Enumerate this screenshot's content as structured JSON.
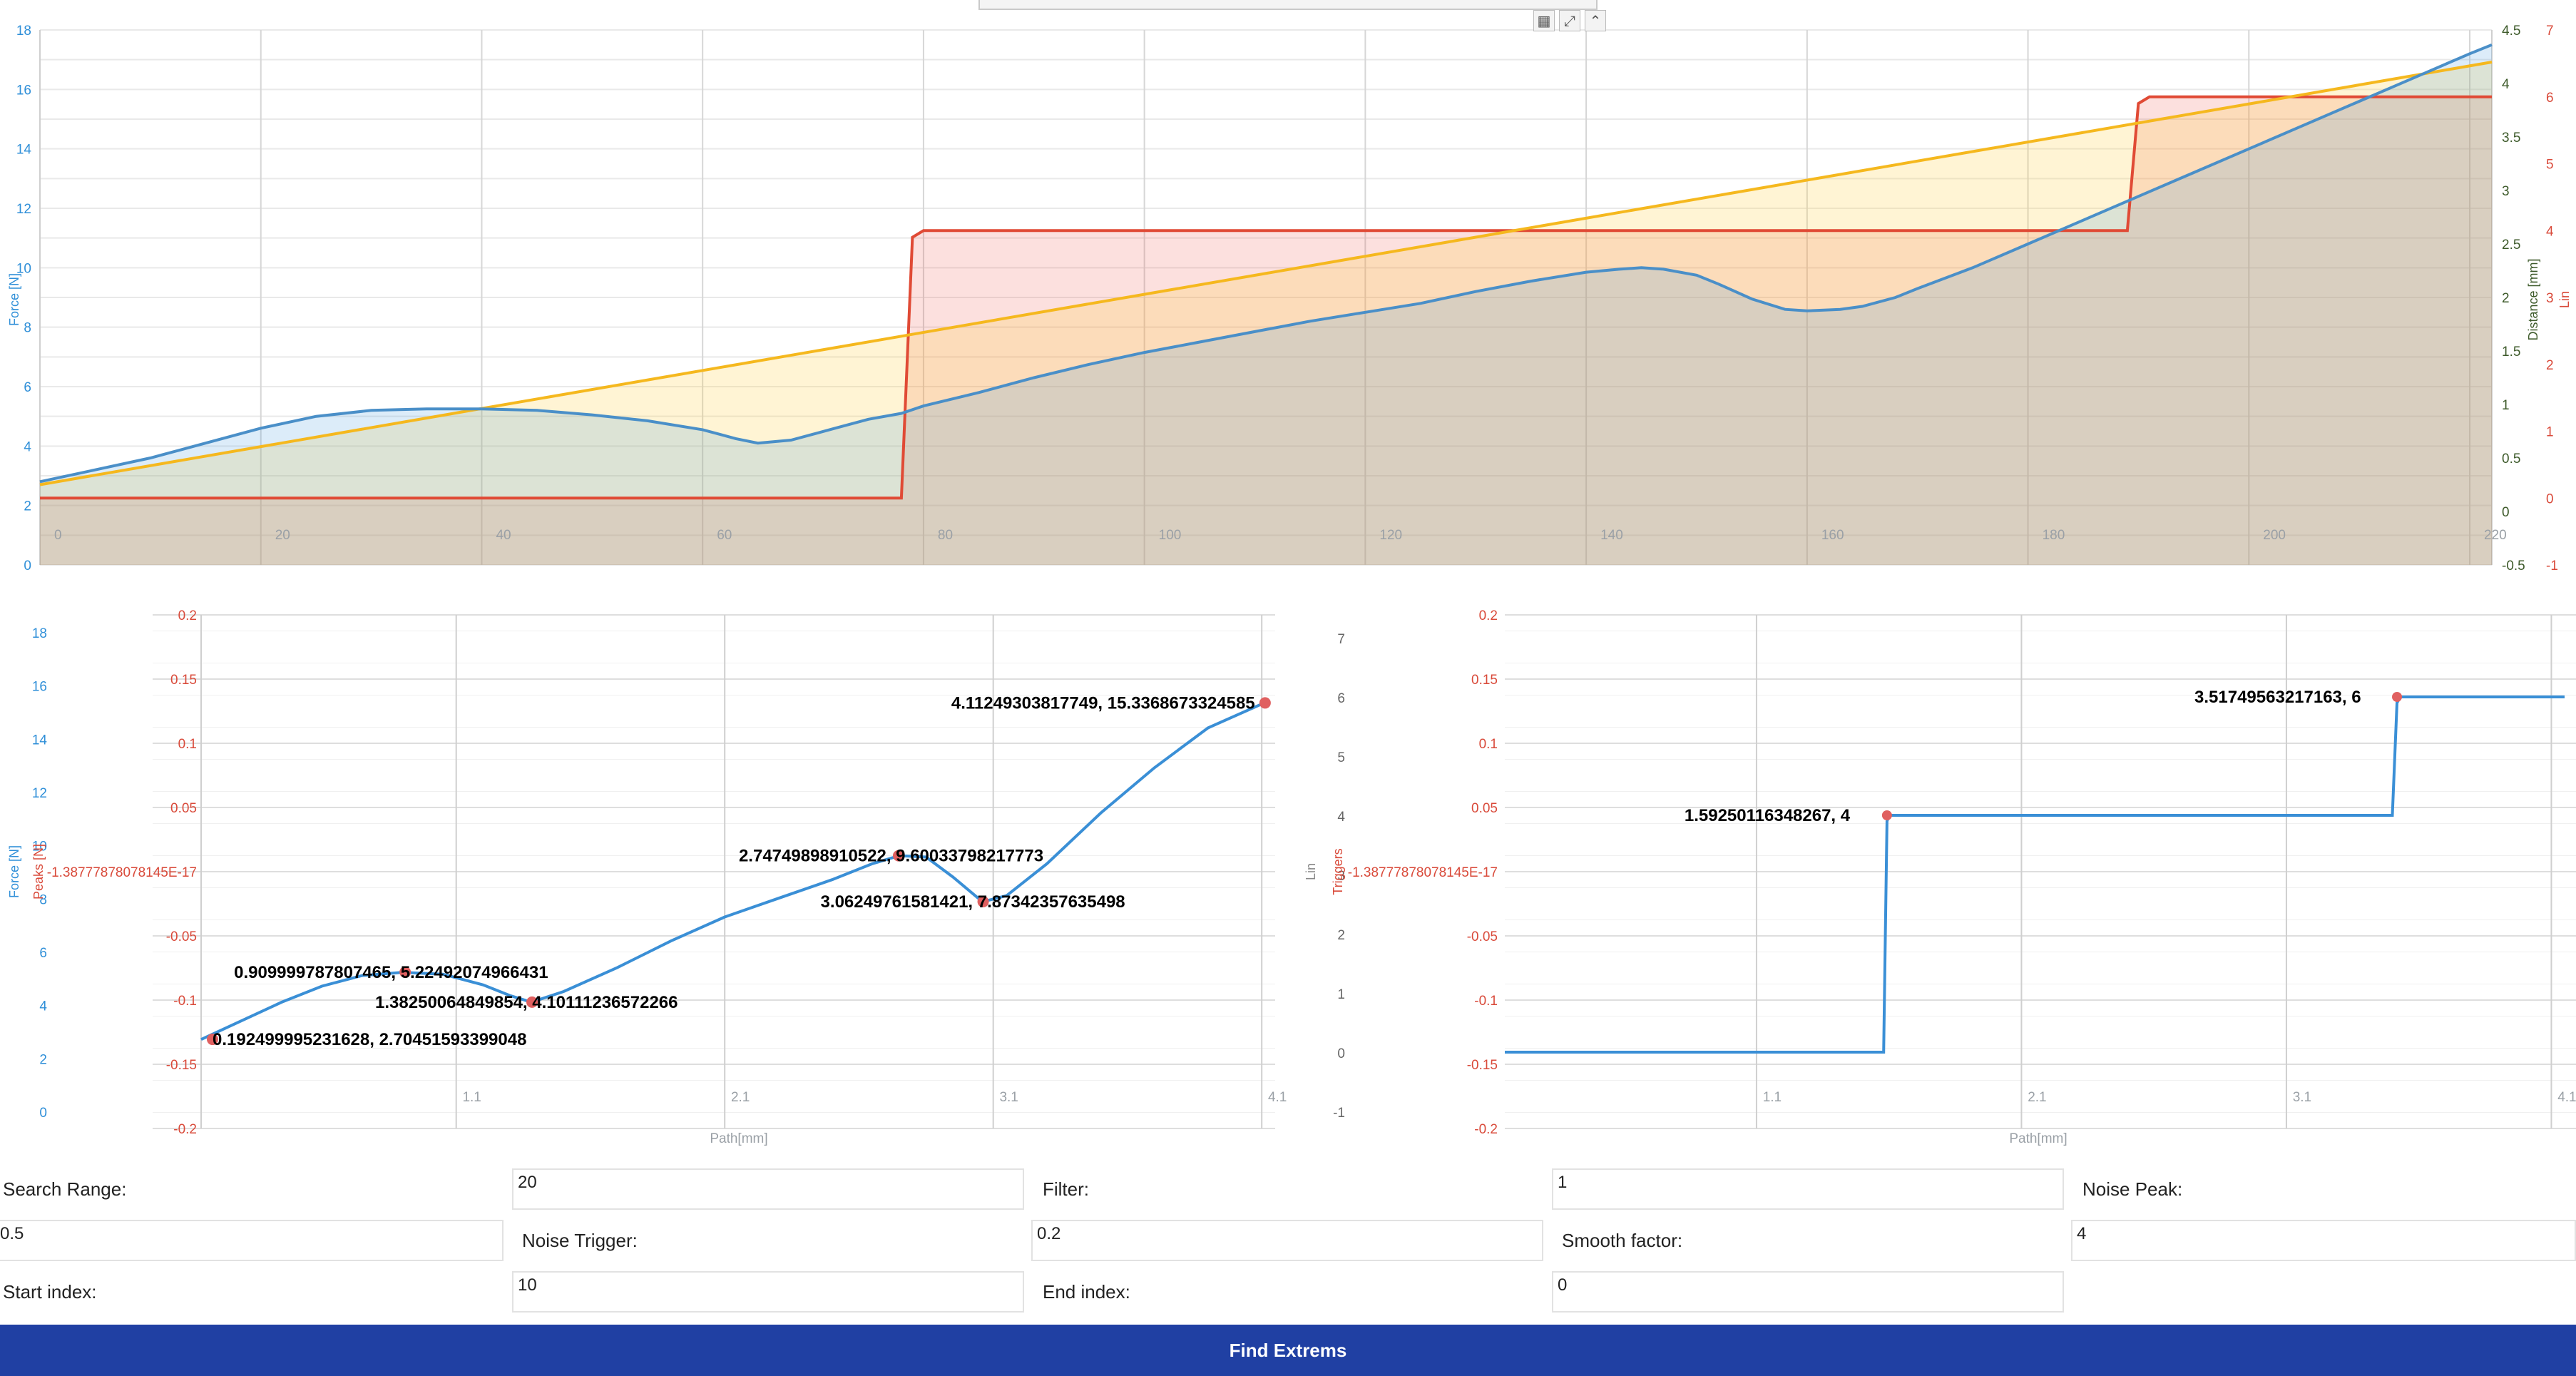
{
  "top_chart": {
    "y_left": {
      "label": "Force [N]",
      "ticks": [
        "0",
        "2",
        "4",
        "6",
        "8",
        "10",
        "12",
        "14",
        "16",
        "18"
      ],
      "color": "#2f8fd8"
    },
    "y_right1": {
      "label": "Distance [mm]",
      "ticks": [
        "-0.5",
        "0",
        "0.5",
        "1",
        "1.5",
        "2",
        "2.5",
        "3",
        "3.5",
        "4",
        "4.5"
      ],
      "color": "#4a6b2f"
    },
    "y_right2": {
      "label": "Lin",
      "ticks": [
        "-1",
        "0",
        "1",
        "2",
        "3",
        "4",
        "5",
        "6",
        "7"
      ],
      "color": "#d94a3a"
    },
    "x_ticks": [
      "0",
      "20",
      "40",
      "60",
      "80",
      "100",
      "120",
      "140",
      "160",
      "180",
      "200",
      "220"
    ]
  },
  "left_chart": {
    "y_force": {
      "label": "Force [N]",
      "ticks": [
        "0",
        "2",
        "4",
        "6",
        "8",
        "10",
        "12",
        "14",
        "16",
        "18"
      ]
    },
    "y_peaks": {
      "label": "Peaks [N]",
      "ticks": [
        "-0.2",
        "-0.15",
        "-0.1",
        "-0.05",
        "-1.38777878078145E-17",
        "0.05",
        "0.1",
        "0.15",
        "0.2"
      ]
    },
    "x_label": "Path[mm]",
    "x_ticks": [
      "1.1",
      "2.1",
      "3.1",
      "4.1"
    ],
    "annotations": [
      "0.192499995231628, 2.70451593399048",
      "0.909999787807465, 5.22492074966431",
      "1.38250064849854, 4.10111236572266",
      "2.74749898910522, 9.60033798217773",
      "3.06249761581421, 7.87342357635498",
      "4.11249303817749, 15.3368673324585"
    ]
  },
  "right_chart": {
    "y_lin": {
      "label": "Lin",
      "ticks": [
        "-1",
        "0",
        "1",
        "2",
        "3",
        "4",
        "5",
        "6",
        "7"
      ]
    },
    "y_triggers": {
      "label": "Triggers",
      "ticks": [
        "-0.2",
        "-0.15",
        "-0.1",
        "-0.05",
        "-1.38777878078145E-17",
        "0.05",
        "0.1",
        "0.15",
        "0.2"
      ]
    },
    "x_label": "Path[mm]",
    "x_ticks": [
      "1.1",
      "2.1",
      "3.1",
      "4.1"
    ],
    "annotations": [
      "1.59250116348267, 4",
      "3.51749563217163, 6"
    ]
  },
  "chart_data": [
    {
      "type": "area",
      "x_range": [
        0,
        222
      ],
      "x_ticks": [
        0,
        20,
        40,
        60,
        80,
        100,
        120,
        140,
        160,
        180,
        200,
        220
      ],
      "series": [
        {
          "name": "Force [N]",
          "axis": "left",
          "ylim": [
            0,
            18
          ],
          "color": "#3a8fd6",
          "x": [
            0,
            5,
            10,
            15,
            20,
            25,
            30,
            35,
            40,
            45,
            50,
            55,
            60,
            63,
            65,
            68,
            70,
            72,
            75,
            78,
            80,
            85,
            90,
            95,
            100,
            105,
            110,
            115,
            120,
            125,
            130,
            135,
            140,
            143,
            145,
            147,
            150,
            152,
            155,
            158,
            160,
            163,
            165,
            168,
            170,
            175,
            180,
            185,
            190,
            195,
            200,
            205,
            210,
            215,
            220,
            222
          ],
          "y": [
            2.8,
            3.2,
            3.6,
            4.1,
            4.6,
            5.0,
            5.2,
            5.25,
            5.25,
            5.2,
            5.05,
            4.85,
            4.55,
            4.25,
            4.1,
            4.2,
            4.4,
            4.6,
            4.9,
            5.1,
            5.35,
            5.8,
            6.3,
            6.75,
            7.15,
            7.5,
            7.85,
            8.2,
            8.5,
            8.8,
            9.2,
            9.55,
            9.85,
            9.95,
            10.0,
            9.95,
            9.75,
            9.45,
            8.95,
            8.6,
            8.55,
            8.6,
            8.7,
            9.0,
            9.3,
            10.0,
            10.8,
            11.6,
            12.4,
            13.2,
            14.0,
            14.8,
            15.6,
            16.4,
            17.2,
            17.5
          ]
        },
        {
          "name": "Distance [mm]",
          "axis": "right1",
          "ylim": [
            -0.5,
            4.5
          ],
          "color": "#f5b81e",
          "x": [
            0,
            222
          ],
          "y": [
            0.25,
            4.2
          ]
        },
        {
          "name": "Lin",
          "axis": "right2",
          "ylim": [
            -1,
            7
          ],
          "color": "#e04a35",
          "x": [
            0,
            78,
            79,
            80,
            189,
            190,
            191,
            222
          ],
          "y": [
            0,
            0,
            3.9,
            4.0,
            4.0,
            5.9,
            6.0,
            6.0
          ]
        }
      ]
    },
    {
      "type": "line",
      "xlabel": "Path[mm]",
      "xlim": [
        0.15,
        4.15
      ],
      "ylim": [
        0,
        18
      ],
      "x_ticks": [
        1.1,
        2.1,
        3.1,
        4.1
      ],
      "series": [
        {
          "name": "Force [N]",
          "x": [
            0.15,
            0.3,
            0.45,
            0.6,
            0.75,
            0.9,
            1.05,
            1.2,
            1.3,
            1.38,
            1.5,
            1.7,
            1.9,
            2.1,
            2.3,
            2.5,
            2.65,
            2.75,
            2.85,
            2.95,
            3.06,
            3.15,
            3.3,
            3.5,
            3.7,
            3.9,
            4.11
          ],
          "y": [
            2.7,
            3.4,
            4.1,
            4.7,
            5.1,
            5.22,
            5.15,
            4.75,
            4.35,
            4.1,
            4.5,
            5.4,
            6.4,
            7.3,
            8.0,
            8.7,
            9.3,
            9.6,
            9.55,
            8.8,
            7.87,
            8.1,
            9.3,
            11.2,
            12.9,
            14.4,
            15.34
          ]
        }
      ],
      "points": [
        [
          0.1925,
          2.7045
        ],
        [
          0.91,
          5.2249
        ],
        [
          1.3825,
          4.1011
        ],
        [
          2.7475,
          9.6003
        ],
        [
          3.0625,
          7.8734
        ],
        [
          4.1125,
          15.3369
        ]
      ]
    },
    {
      "type": "line",
      "xlabel": "Path[mm]",
      "xlim": [
        0.15,
        4.15
      ],
      "ylim": [
        -1,
        7
      ],
      "x_ticks": [
        1.1,
        2.1,
        3.1,
        4.1
      ],
      "series": [
        {
          "name": "Lin",
          "x": [
            0.15,
            1.58,
            1.5925,
            1.6,
            3.5,
            3.5175,
            3.53,
            4.15
          ],
          "y": [
            0,
            0,
            3.9,
            4,
            4,
            5.9,
            6,
            6
          ]
        }
      ],
      "points": [
        [
          1.5925,
          4
        ],
        [
          3.5175,
          6
        ]
      ]
    }
  ],
  "form": {
    "search_range_label": "Search Range:",
    "search_range_value": "20",
    "filter_label": "Filter:",
    "filter_value": "1",
    "noise_peak_label": "Noise Peak:",
    "noise_peak_value": "0.5",
    "noise_trigger_label": "Noise Trigger:",
    "noise_trigger_value": "0.2",
    "smooth_factor_label": "Smooth factor:",
    "smooth_factor_value": "4",
    "start_index_label": "Start index:",
    "start_index_value": "10",
    "end_index_label": "End index:",
    "end_index_value": "0"
  },
  "find_button": "Find Extrems",
  "colors": {
    "force": "#3a8fd6",
    "distance": "#f5b81e",
    "lin": "#e04a35",
    "button": "#2040a3"
  }
}
